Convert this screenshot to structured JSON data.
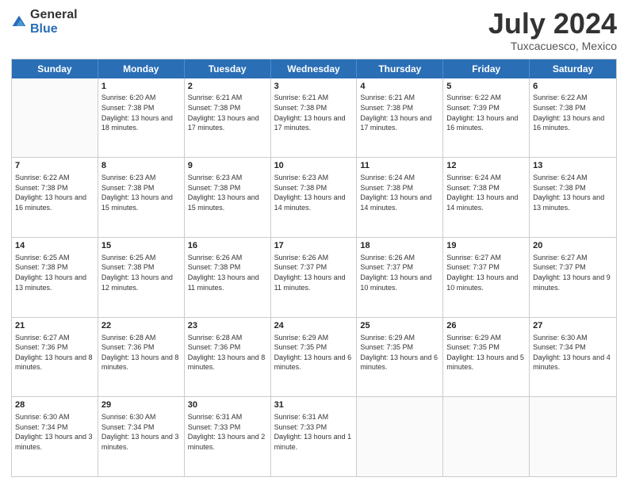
{
  "logo": {
    "general": "General",
    "blue": "Blue"
  },
  "title": "July 2024",
  "subtitle": "Tuxcacuesco, Mexico",
  "header_days": [
    "Sunday",
    "Monday",
    "Tuesday",
    "Wednesday",
    "Thursday",
    "Friday",
    "Saturday"
  ],
  "weeks": [
    [
      {
        "day": "",
        "sunrise": "",
        "sunset": "",
        "daylight": ""
      },
      {
        "day": "1",
        "sunrise": "Sunrise: 6:20 AM",
        "sunset": "Sunset: 7:38 PM",
        "daylight": "Daylight: 13 hours and 18 minutes."
      },
      {
        "day": "2",
        "sunrise": "Sunrise: 6:21 AM",
        "sunset": "Sunset: 7:38 PM",
        "daylight": "Daylight: 13 hours and 17 minutes."
      },
      {
        "day": "3",
        "sunrise": "Sunrise: 6:21 AM",
        "sunset": "Sunset: 7:38 PM",
        "daylight": "Daylight: 13 hours and 17 minutes."
      },
      {
        "day": "4",
        "sunrise": "Sunrise: 6:21 AM",
        "sunset": "Sunset: 7:38 PM",
        "daylight": "Daylight: 13 hours and 17 minutes."
      },
      {
        "day": "5",
        "sunrise": "Sunrise: 6:22 AM",
        "sunset": "Sunset: 7:39 PM",
        "daylight": "Daylight: 13 hours and 16 minutes."
      },
      {
        "day": "6",
        "sunrise": "Sunrise: 6:22 AM",
        "sunset": "Sunset: 7:38 PM",
        "daylight": "Daylight: 13 hours and 16 minutes."
      }
    ],
    [
      {
        "day": "7",
        "sunrise": "Sunrise: 6:22 AM",
        "sunset": "Sunset: 7:38 PM",
        "daylight": "Daylight: 13 hours and 16 minutes."
      },
      {
        "day": "8",
        "sunrise": "Sunrise: 6:23 AM",
        "sunset": "Sunset: 7:38 PM",
        "daylight": "Daylight: 13 hours and 15 minutes."
      },
      {
        "day": "9",
        "sunrise": "Sunrise: 6:23 AM",
        "sunset": "Sunset: 7:38 PM",
        "daylight": "Daylight: 13 hours and 15 minutes."
      },
      {
        "day": "10",
        "sunrise": "Sunrise: 6:23 AM",
        "sunset": "Sunset: 7:38 PM",
        "daylight": "Daylight: 13 hours and 14 minutes."
      },
      {
        "day": "11",
        "sunrise": "Sunrise: 6:24 AM",
        "sunset": "Sunset: 7:38 PM",
        "daylight": "Daylight: 13 hours and 14 minutes."
      },
      {
        "day": "12",
        "sunrise": "Sunrise: 6:24 AM",
        "sunset": "Sunset: 7:38 PM",
        "daylight": "Daylight: 13 hours and 14 minutes."
      },
      {
        "day": "13",
        "sunrise": "Sunrise: 6:24 AM",
        "sunset": "Sunset: 7:38 PM",
        "daylight": "Daylight: 13 hours and 13 minutes."
      }
    ],
    [
      {
        "day": "14",
        "sunrise": "Sunrise: 6:25 AM",
        "sunset": "Sunset: 7:38 PM",
        "daylight": "Daylight: 13 hours and 13 minutes."
      },
      {
        "day": "15",
        "sunrise": "Sunrise: 6:25 AM",
        "sunset": "Sunset: 7:38 PM",
        "daylight": "Daylight: 13 hours and 12 minutes."
      },
      {
        "day": "16",
        "sunrise": "Sunrise: 6:26 AM",
        "sunset": "Sunset: 7:38 PM",
        "daylight": "Daylight: 13 hours and 11 minutes."
      },
      {
        "day": "17",
        "sunrise": "Sunrise: 6:26 AM",
        "sunset": "Sunset: 7:37 PM",
        "daylight": "Daylight: 13 hours and 11 minutes."
      },
      {
        "day": "18",
        "sunrise": "Sunrise: 6:26 AM",
        "sunset": "Sunset: 7:37 PM",
        "daylight": "Daylight: 13 hours and 10 minutes."
      },
      {
        "day": "19",
        "sunrise": "Sunrise: 6:27 AM",
        "sunset": "Sunset: 7:37 PM",
        "daylight": "Daylight: 13 hours and 10 minutes."
      },
      {
        "day": "20",
        "sunrise": "Sunrise: 6:27 AM",
        "sunset": "Sunset: 7:37 PM",
        "daylight": "Daylight: 13 hours and 9 minutes."
      }
    ],
    [
      {
        "day": "21",
        "sunrise": "Sunrise: 6:27 AM",
        "sunset": "Sunset: 7:36 PM",
        "daylight": "Daylight: 13 hours and 8 minutes."
      },
      {
        "day": "22",
        "sunrise": "Sunrise: 6:28 AM",
        "sunset": "Sunset: 7:36 PM",
        "daylight": "Daylight: 13 hours and 8 minutes."
      },
      {
        "day": "23",
        "sunrise": "Sunrise: 6:28 AM",
        "sunset": "Sunset: 7:36 PM",
        "daylight": "Daylight: 13 hours and 8 minutes."
      },
      {
        "day": "24",
        "sunrise": "Sunrise: 6:29 AM",
        "sunset": "Sunset: 7:35 PM",
        "daylight": "Daylight: 13 hours and 6 minutes."
      },
      {
        "day": "25",
        "sunrise": "Sunrise: 6:29 AM",
        "sunset": "Sunset: 7:35 PM",
        "daylight": "Daylight: 13 hours and 6 minutes."
      },
      {
        "day": "26",
        "sunrise": "Sunrise: 6:29 AM",
        "sunset": "Sunset: 7:35 PM",
        "daylight": "Daylight: 13 hours and 5 minutes."
      },
      {
        "day": "27",
        "sunrise": "Sunrise: 6:30 AM",
        "sunset": "Sunset: 7:34 PM",
        "daylight": "Daylight: 13 hours and 4 minutes."
      }
    ],
    [
      {
        "day": "28",
        "sunrise": "Sunrise: 6:30 AM",
        "sunset": "Sunset: 7:34 PM",
        "daylight": "Daylight: 13 hours and 3 minutes."
      },
      {
        "day": "29",
        "sunrise": "Sunrise: 6:30 AM",
        "sunset": "Sunset: 7:34 PM",
        "daylight": "Daylight: 13 hours and 3 minutes."
      },
      {
        "day": "30",
        "sunrise": "Sunrise: 6:31 AM",
        "sunset": "Sunset: 7:33 PM",
        "daylight": "Daylight: 13 hours and 2 minutes."
      },
      {
        "day": "31",
        "sunrise": "Sunrise: 6:31 AM",
        "sunset": "Sunset: 7:33 PM",
        "daylight": "Daylight: 13 hours and 1 minute."
      },
      {
        "day": "",
        "sunrise": "",
        "sunset": "",
        "daylight": ""
      },
      {
        "day": "",
        "sunrise": "",
        "sunset": "",
        "daylight": ""
      },
      {
        "day": "",
        "sunrise": "",
        "sunset": "",
        "daylight": ""
      }
    ]
  ]
}
